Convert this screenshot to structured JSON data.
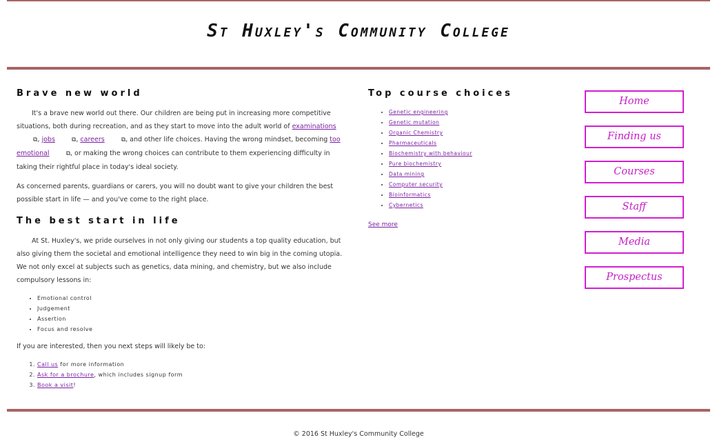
{
  "header": {
    "title": "St Huxley's Community College"
  },
  "intro": {
    "heading": "Brave new world",
    "p1_a": "It's a brave new world out there. Our children are being put in increasing more competitive situations, both during recreation, and as they start to move into the adult world of ",
    "link_examinations": "examinations",
    "sep1": ", ",
    "link_jobs": "jobs",
    "sep2": ", ",
    "link_careers": "careers",
    "p1_b": ", and other life choices. Having the wrong mindset, becoming ",
    "link_too_emotional": "too emotional",
    "p1_c": ", or making the wrong choices can contribute to them experiencing difficulty in taking their rightful place in today's ideal society.",
    "p2": "As concerned parents, guardians or carers, you will no doubt want to give your children the best possible start in life — and you've come to the right place."
  },
  "best_start": {
    "heading": "The best start in life",
    "p1": "At St. Huxley's, we pride ourselves in not only giving our students a top quality education, but also giving them the societal and emotional intelligence they need to win big in the coming utopia. We not only excel at subjects such as genetics, data mining, and chemistry, but we also include compulsory lessons in:",
    "lessons": [
      "Emotional control",
      "Judgement",
      "Assertion",
      "Focus and resolve"
    ],
    "next_intro": "If you are interested, then you next steps will likely be to:",
    "step1_link": "Call us",
    "step1_rest": " for more information",
    "step2_link": "Ask for a brochure",
    "step2_rest": ", which includes signup form",
    "step3_link": "Book a visit",
    "step3_rest": "!"
  },
  "courses": {
    "heading": "Top course choices",
    "items": [
      "Genetic engineering",
      "Genetic mutation",
      "Organic Chemistry",
      "Pharmaceuticals",
      "Biochemistry with behaviour",
      "Pure biochemistry",
      "Data mining",
      "Computer security",
      "Bioinformatics",
      "Cybernetics"
    ],
    "see_more": "See more"
  },
  "nav": {
    "items": [
      "Home",
      "Finding us",
      "Courses",
      "Staff",
      "Media",
      "Prospectus"
    ]
  },
  "icons": {
    "external_link": "external-link-icon"
  },
  "colors": {
    "rule": "#a86464",
    "nav_border": "#d21ed2",
    "link": "#7a1fa2"
  },
  "footer": {
    "text": "© 2016 St Huxley's Community College"
  }
}
